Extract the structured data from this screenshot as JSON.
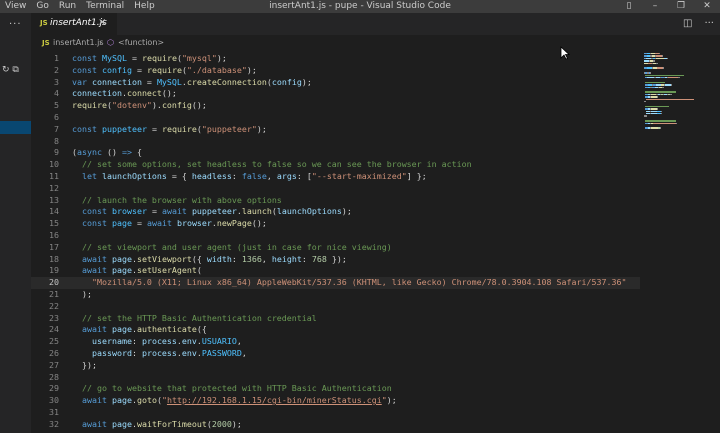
{
  "menu": [
    "View",
    "Go",
    "Run",
    "Terminal",
    "Help"
  ],
  "window_title": "insertAnt1.js - pupe - Visual Studio Code",
  "tab": {
    "icon": "JS",
    "name": "insertAnt1.js",
    "close": "×"
  },
  "breadcrumb": {
    "icon": "JS",
    "file": "insertAnt1.js",
    "sep": "›",
    "symbol": "<function>"
  },
  "sidebar": {
    "more": "···",
    "actions": "↻ ⧉"
  },
  "active_line": 20,
  "lines": [
    {
      "n": "1",
      "t": [
        [
          "kw",
          "const "
        ],
        [
          "const",
          "MySQL"
        ],
        [
          "p",
          " = "
        ],
        [
          "fn",
          "require"
        ],
        [
          "p",
          "("
        ],
        [
          "str",
          "\"mysql\""
        ],
        [
          "p",
          ");"
        ]
      ]
    },
    {
      "n": "2",
      "t": [
        [
          "kw",
          "const "
        ],
        [
          "const",
          "config"
        ],
        [
          "p",
          " = "
        ],
        [
          "fn",
          "require"
        ],
        [
          "p",
          "("
        ],
        [
          "str",
          "\"./database\""
        ],
        [
          "p",
          ");"
        ]
      ]
    },
    {
      "n": "3",
      "t": [
        [
          "kw",
          "var "
        ],
        [
          "var",
          "connection"
        ],
        [
          "p",
          " = "
        ],
        [
          "const",
          "MySQL"
        ],
        [
          "p",
          "."
        ],
        [
          "fn",
          "createConnection"
        ],
        [
          "p",
          "("
        ],
        [
          "var",
          "config"
        ],
        [
          "p",
          ");"
        ]
      ]
    },
    {
      "n": "4",
      "t": [
        [
          "var",
          "connection"
        ],
        [
          "p",
          "."
        ],
        [
          "fn",
          "connect"
        ],
        [
          "p",
          "();"
        ]
      ]
    },
    {
      "n": "5",
      "t": [
        [
          "fn",
          "require"
        ],
        [
          "p",
          "("
        ],
        [
          "str",
          "\"dotenv\""
        ],
        [
          "p",
          ")."
        ],
        [
          "fn",
          "config"
        ],
        [
          "p",
          "();"
        ]
      ]
    },
    {
      "n": "6",
      "t": []
    },
    {
      "n": "7",
      "t": [
        [
          "kw",
          "const "
        ],
        [
          "const",
          "puppeteer"
        ],
        [
          "p",
          " = "
        ],
        [
          "fn",
          "require"
        ],
        [
          "p",
          "("
        ],
        [
          "str",
          "\"puppeteer\""
        ],
        [
          "p",
          ");"
        ]
      ]
    },
    {
      "n": "8",
      "t": []
    },
    {
      "n": "9",
      "t": [
        [
          "p",
          "("
        ],
        [
          "kw",
          "async"
        ],
        [
          "p",
          " () "
        ],
        [
          "kw",
          "=>"
        ],
        [
          "p",
          " {"
        ]
      ]
    },
    {
      "n": "10",
      "t": [
        [
          "p",
          "  "
        ],
        [
          "cm",
          "// set some options, set headless to false so we can see the browser in action"
        ]
      ]
    },
    {
      "n": "11",
      "t": [
        [
          "p",
          "  "
        ],
        [
          "kw",
          "let "
        ],
        [
          "var",
          "launchOptions"
        ],
        [
          "p",
          " = { "
        ],
        [
          "var",
          "headless"
        ],
        [
          "p",
          ": "
        ],
        [
          "kw",
          "false"
        ],
        [
          "p",
          ", "
        ],
        [
          "var",
          "args"
        ],
        [
          "p",
          ": ["
        ],
        [
          "str",
          "\"--start-maximized\""
        ],
        [
          "p",
          "] };"
        ]
      ]
    },
    {
      "n": "12",
      "t": []
    },
    {
      "n": "13",
      "t": [
        [
          "p",
          "  "
        ],
        [
          "cm",
          "// launch the browser with above options"
        ]
      ]
    },
    {
      "n": "14",
      "t": [
        [
          "p",
          "  "
        ],
        [
          "kw",
          "const "
        ],
        [
          "const",
          "browser"
        ],
        [
          "p",
          " = "
        ],
        [
          "kw",
          "await "
        ],
        [
          "var",
          "puppeteer"
        ],
        [
          "p",
          "."
        ],
        [
          "fn",
          "launch"
        ],
        [
          "p",
          "("
        ],
        [
          "var",
          "launchOptions"
        ],
        [
          "p",
          ");"
        ]
      ]
    },
    {
      "n": "15",
      "t": [
        [
          "p",
          "  "
        ],
        [
          "kw",
          "const "
        ],
        [
          "const",
          "page"
        ],
        [
          "p",
          " = "
        ],
        [
          "kw",
          "await "
        ],
        [
          "var",
          "browser"
        ],
        [
          "p",
          "."
        ],
        [
          "fn",
          "newPage"
        ],
        [
          "p",
          "();"
        ]
      ]
    },
    {
      "n": "16",
      "t": []
    },
    {
      "n": "17",
      "t": [
        [
          "p",
          "  "
        ],
        [
          "cm",
          "// set viewport and user agent (just in case for nice viewing)"
        ]
      ]
    },
    {
      "n": "18",
      "t": [
        [
          "p",
          "  "
        ],
        [
          "kw",
          "await "
        ],
        [
          "var",
          "page"
        ],
        [
          "p",
          "."
        ],
        [
          "fn",
          "setViewport"
        ],
        [
          "p",
          "({ "
        ],
        [
          "var",
          "width"
        ],
        [
          "p",
          ": "
        ],
        [
          "num",
          "1366"
        ],
        [
          "p",
          ", "
        ],
        [
          "var",
          "height"
        ],
        [
          "p",
          ": "
        ],
        [
          "num",
          "768"
        ],
        [
          "p",
          " });"
        ]
      ]
    },
    {
      "n": "19",
      "t": [
        [
          "p",
          "  "
        ],
        [
          "kw",
          "await "
        ],
        [
          "var",
          "page"
        ],
        [
          "p",
          "."
        ],
        [
          "fn",
          "setUserAgent"
        ],
        [
          "p",
          "("
        ]
      ]
    },
    {
      "n": "20",
      "t": [
        [
          "p",
          "    "
        ],
        [
          "str",
          "\"Mozilla/5.0 (X11; Linux x86_64) AppleWebKit/537.36 (KHTML, like Gecko) Chrome/78.0.3904.108 Safari/537.36\""
        ]
      ]
    },
    {
      "n": "21",
      "t": [
        [
          "p",
          "  );"
        ]
      ]
    },
    {
      "n": "22",
      "t": []
    },
    {
      "n": "23",
      "t": [
        [
          "p",
          "  "
        ],
        [
          "cm",
          "// set the HTTP Basic Authentication credential"
        ]
      ]
    },
    {
      "n": "24",
      "t": [
        [
          "p",
          "  "
        ],
        [
          "kw",
          "await "
        ],
        [
          "var",
          "page"
        ],
        [
          "p",
          "."
        ],
        [
          "fn",
          "authenticate"
        ],
        [
          "p",
          "({"
        ]
      ]
    },
    {
      "n": "25",
      "t": [
        [
          "p",
          "    "
        ],
        [
          "var",
          "username"
        ],
        [
          "p",
          ": "
        ],
        [
          "var",
          "process"
        ],
        [
          "p",
          "."
        ],
        [
          "var",
          "env"
        ],
        [
          "p",
          "."
        ],
        [
          "const",
          "USUARIO"
        ],
        [
          "p",
          ","
        ]
      ]
    },
    {
      "n": "26",
      "t": [
        [
          "p",
          "    "
        ],
        [
          "var",
          "password"
        ],
        [
          "p",
          ": "
        ],
        [
          "var",
          "process"
        ],
        [
          "p",
          "."
        ],
        [
          "var",
          "env"
        ],
        [
          "p",
          "."
        ],
        [
          "const",
          "PASSWORD"
        ],
        [
          "p",
          ","
        ]
      ]
    },
    {
      "n": "27",
      "t": [
        [
          "p",
          "  });"
        ]
      ]
    },
    {
      "n": "28",
      "t": []
    },
    {
      "n": "29",
      "t": [
        [
          "p",
          "  "
        ],
        [
          "cm",
          "// go to website that protected with HTTP Basic Authentication"
        ]
      ]
    },
    {
      "n": "30",
      "t": [
        [
          "p",
          "  "
        ],
        [
          "kw",
          "await "
        ],
        [
          "var",
          "page"
        ],
        [
          "p",
          "."
        ],
        [
          "fn",
          "goto"
        ],
        [
          "p",
          "("
        ],
        [
          "str",
          "\""
        ],
        [
          "strul",
          "http://192.168.1.15/cgi-bin/minerStatus.cgi"
        ],
        [
          "str",
          "\""
        ],
        [
          "p",
          ");"
        ]
      ]
    },
    {
      "n": "31",
      "t": []
    },
    {
      "n": "32",
      "t": [
        [
          "p",
          "  "
        ],
        [
          "kw",
          "await "
        ],
        [
          "var",
          "page"
        ],
        [
          "p",
          "."
        ],
        [
          "fn",
          "waitForTimeout"
        ],
        [
          "p",
          "("
        ],
        [
          "num",
          "2000"
        ],
        [
          "p",
          ");"
        ]
      ]
    }
  ],
  "colors": {
    "keyword": "#569cd6",
    "variable": "#9cdcfe",
    "function": "#dcdcaa",
    "string": "#ce9178",
    "comment": "#6a9955",
    "number": "#b5cea8",
    "constant": "#4fc1ff"
  }
}
